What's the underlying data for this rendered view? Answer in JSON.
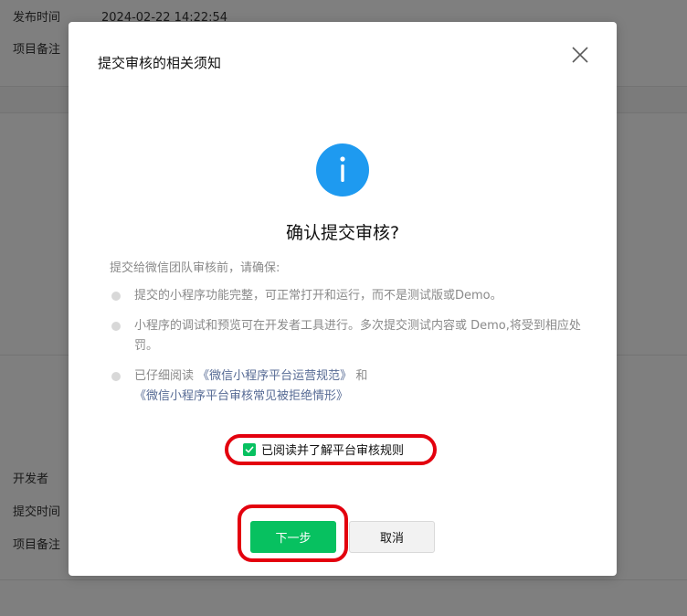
{
  "background": {
    "top_rows": [
      {
        "label": "发布时间",
        "value": "2024-02-22 14:22:54"
      },
      {
        "label": "项目备注",
        "value": ""
      }
    ],
    "bottom_rows": [
      {
        "label": "开发者",
        "value": ""
      },
      {
        "label": "提交时间",
        "value": ""
      },
      {
        "label": "项目备注",
        "value": ""
      }
    ]
  },
  "dialog": {
    "title": "提交审核的相关须知",
    "heading": "确认提交审核?",
    "intro": "提交给微信团队审核前，请确保:",
    "bullets": {
      "b1": "提交的小程序功能完整，可正常打开和运行，而不是测试版或Demo。",
      "b2": "小程序的调试和预览可在开发者工具进行。多次提交测试内容或 Demo,将受到相应处罚。",
      "b3_prefix": "已仔细阅读",
      "b3_link1": "《微信小程序平台运营规范》",
      "b3_mid": "和",
      "b3_link2": "《微信小程序平台审核常见被拒绝情形》"
    },
    "agree_label": "已阅读并了解平台审核规则",
    "agree_checked": true,
    "next_label": "下一步",
    "cancel_label": "取消",
    "icons": {
      "close": "close-icon",
      "info": "info-icon",
      "check": "check-icon"
    },
    "colors": {
      "primary": "#07c160",
      "info": "#1e9af0",
      "link": "#576b95",
      "annotation": "#e3000e"
    }
  }
}
